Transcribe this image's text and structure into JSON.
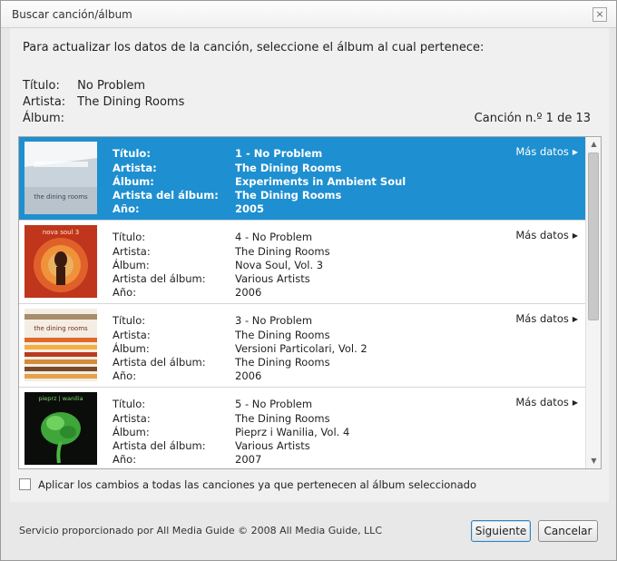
{
  "window": {
    "title": "Buscar canción/álbum",
    "close": "×"
  },
  "instruction": "Para actualizar los datos de la canción, seleccione el álbum al cual pertenece:",
  "song": {
    "title_label": "Título:",
    "title": "No Problem",
    "artist_label": "Artista:",
    "artist": "The Dining Rooms",
    "album_label": "Álbum:",
    "album": ""
  },
  "song_count": "Canción n.º 1 de 13",
  "field_labels": {
    "title": "Título:",
    "artist": "Artista:",
    "album": "Álbum:",
    "album_artist": "Artista del álbum:",
    "year": "Año:"
  },
  "more_label": "Más datos",
  "results": [
    {
      "title": "1 - No Problem",
      "artist": "The Dining Rooms",
      "album": "Experiments in Ambient Soul",
      "album_artist": "The Dining Rooms",
      "year": "2005",
      "selected": true,
      "cover_text": "the dining rooms"
    },
    {
      "title": "4 - No Problem",
      "artist": "The Dining Rooms",
      "album": "Nova Soul, Vol. 3",
      "album_artist": "Various Artists",
      "year": "2006",
      "selected": false,
      "cover_text": "nova soul 3"
    },
    {
      "title": "3 - No Problem",
      "artist": "The Dining Rooms",
      "album": "Versioni Particolari, Vol. 2",
      "album_artist": "The Dining Rooms",
      "year": "2006",
      "selected": false,
      "cover_text": "the dining rooms"
    },
    {
      "title": "5 - No Problem",
      "artist": "The Dining Rooms",
      "album": "Pieprz i Wanilia, Vol. 4",
      "album_artist": "Various Artists",
      "year": "2007",
      "selected": false,
      "cover_text": "pieprz | wanilia"
    }
  ],
  "apply_all_label": "Aplicar los cambios a todas las canciones ya que pertenecen al álbum seleccionado",
  "footer": "Servicio proporcionado por All Media Guide © 2008 All Media Guide, LLC",
  "buttons": {
    "next": "Siguiente",
    "cancel": "Cancelar"
  }
}
